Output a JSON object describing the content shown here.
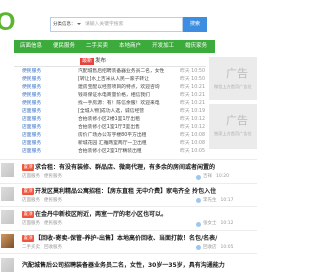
{
  "header": {
    "logo_text": "O",
    "search": {
      "category_label": "分类信息：",
      "placeholder": "请输入关键字搜索",
      "button_label": "搜索"
    }
  },
  "nav": {
    "items": [
      "店面信息",
      "便民服务",
      "二手买卖",
      "本地商户",
      "开发加工",
      "婚庆家务"
    ]
  },
  "latest": {
    "tag": "最新",
    "title": "发布",
    "rows": [
      {
        "category": "便民服务",
        "title": "汽配城售后招聘装备器业务员二名，女性",
        "time": "昨天 10:50"
      },
      {
        "category": "便民服务",
        "title": "[转让]水上吉米从人民一家子转让",
        "time": "昨天 10:50"
      },
      {
        "category": "便民服务",
        "title": "建房宝配以经营项目的特点，欢迎咨询",
        "time": "昨天 10:21"
      },
      {
        "category": "便民服务",
        "title": "钱哥保证水电商量价格，相信我们",
        "time": "昨天 10:21"
      },
      {
        "category": "便民服务",
        "title": "找一手房源：有！陈信余服！欢迎来电",
        "time": "昨天 10:21"
      },
      {
        "category": "店面服务",
        "title": "[全城人物]成功人选，诚信经营",
        "time": "昨天 10:19"
      },
      {
        "category": "店面服务",
        "title": "合拍装修小区2楼1室1厅出租",
        "time": "昨天 10:12"
      },
      {
        "category": "店面服务",
        "title": "合拍装修小区1室1厅3室出售",
        "time": "昨天 10:12"
      },
      {
        "category": "店面服务",
        "title": "房价广场办公写字楼80平方出租",
        "time": "昨天 10:08"
      },
      {
        "category": "店面服务",
        "title": "新城花园 汇雅两室两厅一卫出租",
        "time": "昨天 10:08"
      },
      {
        "category": "店面服务",
        "title": "合拍装修小区2室1厅精装出租",
        "time": "昨天 10:05"
      }
    ]
  },
  "ads": [
    {
      "title": "广告",
      "note": "微信上方首页广告位"
    },
    {
      "title": "广告",
      "note": "独家上方首页广告位"
    }
  ],
  "featured": {
    "items": [
      {
        "tag": "置顶",
        "title": "求合租：有没有装修、群品店、微商代理，有多余的房间或者闲置的",
        "categories": [
          "店面服务",
          "便民服务"
        ],
        "user": "吉祥",
        "time": "10:20"
      },
      {
        "tag": "置顶",
        "title": "开发区莫利精品公寓招租：【房东直租 无中介费】家电齐全 拎包入住",
        "categories": [
          "店面服务",
          "便民服务"
        ],
        "user": "李先生",
        "time": "10:17"
      },
      {
        "tag": "置顶",
        "title": "在金丹中新校区附近，两室一厅的老小区也可以。",
        "categories": [
          "店面服务",
          "便民服务"
        ],
        "user": "张女士",
        "time": "10:12"
      },
      {
        "tag": "置顶",
        "title": "【回收-寄卖-保管-养护-出售】本地高价回收、当面打款！名包/名表/",
        "categories": [
          "二手买卖",
          "回收服务"
        ],
        "user": "回收店",
        "time": "10:05"
      },
      {
        "title": "汽配城售后公司招聘装备器业务员二名，女性，30岁一35岁，具有沟通能力"
      }
    ]
  },
  "colors": {
    "logo": "#5cb531",
    "nav": "#3bab3b",
    "search_button": "#3d8ee0",
    "tag_latest": "#e8423f",
    "tag_top": "#f0543c",
    "category_link": "#3b72c2",
    "ad_bg": "#ebebeb"
  },
  "icons": {
    "category_dropdown": "chevron-down-icon",
    "user": "avatar-icon"
  }
}
